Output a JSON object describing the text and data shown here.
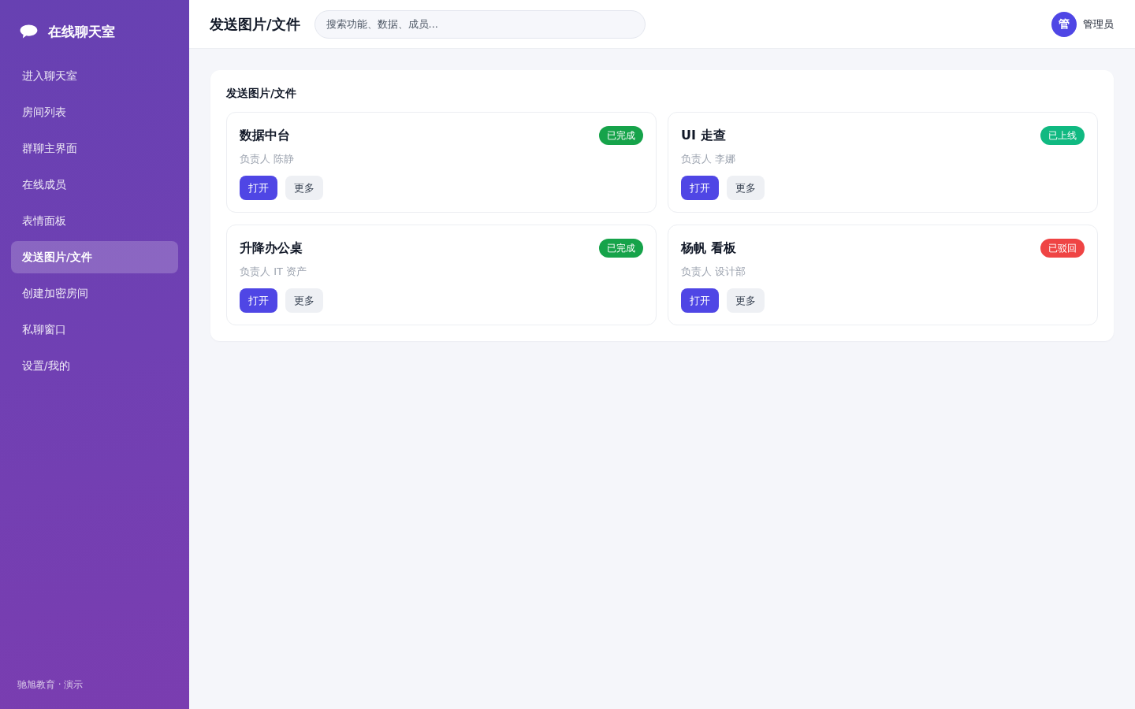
{
  "sidebar": {
    "logo_title": "在线聊天室",
    "items": [
      {
        "label": "进入聊天室",
        "selected": false
      },
      {
        "label": "房间列表",
        "selected": false
      },
      {
        "label": "群聊主界面",
        "selected": false
      },
      {
        "label": "在线成员",
        "selected": false
      },
      {
        "label": "表情面板",
        "selected": false
      },
      {
        "label": "发送图片/文件",
        "selected": true
      },
      {
        "label": "创建加密房间",
        "selected": false
      },
      {
        "label": "私聊窗口",
        "selected": false
      },
      {
        "label": "设置/我的",
        "selected": false
      }
    ],
    "footer": "驰旭教育 · 演示"
  },
  "header": {
    "title": "发送图片/文件",
    "search": {
      "placeholder": "搜索功能、数据、成员..."
    },
    "user": {
      "avatar_text": "管",
      "name": "管理员"
    }
  },
  "panel": {
    "title": "发送图片/文件",
    "cards": [
      {
        "title": "数据中台",
        "owner": "负责人 陈静",
        "status": {
          "label": "已完成",
          "color": "#16a34a"
        },
        "buttons": [
          {
            "label": "打开",
            "kind": "primary"
          },
          {
            "label": "更多",
            "kind": "secondary"
          }
        ]
      },
      {
        "title": "UI 走查",
        "owner": "负责人 李娜",
        "status": {
          "label": "已上线",
          "color": "#10b981"
        },
        "buttons": [
          {
            "label": "打开",
            "kind": "primary"
          },
          {
            "label": "更多",
            "kind": "secondary"
          }
        ]
      },
      {
        "title": "升降办公桌",
        "owner": "负责人 IT 资产",
        "status": {
          "label": "已完成",
          "color": "#16a34a"
        },
        "buttons": [
          {
            "label": "打开",
            "kind": "primary"
          },
          {
            "label": "更多",
            "kind": "secondary"
          }
        ]
      },
      {
        "title": "杨帆 看板",
        "owner": "负责人 设计部",
        "status": {
          "label": "已驳回",
          "color": "#ef4444"
        },
        "buttons": [
          {
            "label": "打开",
            "kind": "primary"
          },
          {
            "label": "更多",
            "kind": "secondary"
          }
        ]
      }
    ]
  }
}
